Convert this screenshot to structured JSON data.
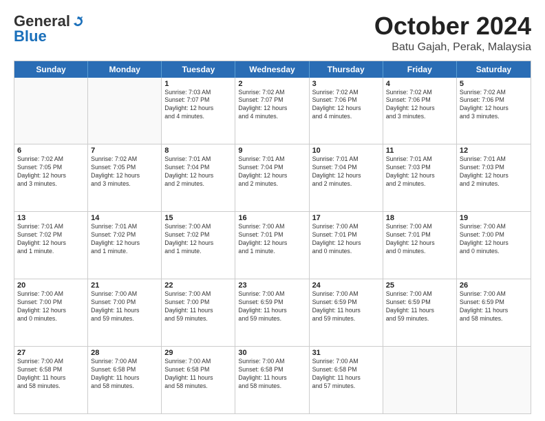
{
  "header": {
    "logo_general": "General",
    "logo_blue": "Blue",
    "month_title": "October 2024",
    "location": "Batu Gajah, Perak, Malaysia"
  },
  "days_of_week": [
    "Sunday",
    "Monday",
    "Tuesday",
    "Wednesday",
    "Thursday",
    "Friday",
    "Saturday"
  ],
  "weeks": [
    [
      {
        "day": "",
        "text": ""
      },
      {
        "day": "",
        "text": ""
      },
      {
        "day": "1",
        "text": "Sunrise: 7:03 AM\nSunset: 7:07 PM\nDaylight: 12 hours\nand 4 minutes."
      },
      {
        "day": "2",
        "text": "Sunrise: 7:02 AM\nSunset: 7:07 PM\nDaylight: 12 hours\nand 4 minutes."
      },
      {
        "day": "3",
        "text": "Sunrise: 7:02 AM\nSunset: 7:06 PM\nDaylight: 12 hours\nand 4 minutes."
      },
      {
        "day": "4",
        "text": "Sunrise: 7:02 AM\nSunset: 7:06 PM\nDaylight: 12 hours\nand 3 minutes."
      },
      {
        "day": "5",
        "text": "Sunrise: 7:02 AM\nSunset: 7:06 PM\nDaylight: 12 hours\nand 3 minutes."
      }
    ],
    [
      {
        "day": "6",
        "text": "Sunrise: 7:02 AM\nSunset: 7:05 PM\nDaylight: 12 hours\nand 3 minutes."
      },
      {
        "day": "7",
        "text": "Sunrise: 7:02 AM\nSunset: 7:05 PM\nDaylight: 12 hours\nand 3 minutes."
      },
      {
        "day": "8",
        "text": "Sunrise: 7:01 AM\nSunset: 7:04 PM\nDaylight: 12 hours\nand 2 minutes."
      },
      {
        "day": "9",
        "text": "Sunrise: 7:01 AM\nSunset: 7:04 PM\nDaylight: 12 hours\nand 2 minutes."
      },
      {
        "day": "10",
        "text": "Sunrise: 7:01 AM\nSunset: 7:04 PM\nDaylight: 12 hours\nand 2 minutes."
      },
      {
        "day": "11",
        "text": "Sunrise: 7:01 AM\nSunset: 7:03 PM\nDaylight: 12 hours\nand 2 minutes."
      },
      {
        "day": "12",
        "text": "Sunrise: 7:01 AM\nSunset: 7:03 PM\nDaylight: 12 hours\nand 2 minutes."
      }
    ],
    [
      {
        "day": "13",
        "text": "Sunrise: 7:01 AM\nSunset: 7:02 PM\nDaylight: 12 hours\nand 1 minute."
      },
      {
        "day": "14",
        "text": "Sunrise: 7:01 AM\nSunset: 7:02 PM\nDaylight: 12 hours\nand 1 minute."
      },
      {
        "day": "15",
        "text": "Sunrise: 7:00 AM\nSunset: 7:02 PM\nDaylight: 12 hours\nand 1 minute."
      },
      {
        "day": "16",
        "text": "Sunrise: 7:00 AM\nSunset: 7:01 PM\nDaylight: 12 hours\nand 1 minute."
      },
      {
        "day": "17",
        "text": "Sunrise: 7:00 AM\nSunset: 7:01 PM\nDaylight: 12 hours\nand 0 minutes."
      },
      {
        "day": "18",
        "text": "Sunrise: 7:00 AM\nSunset: 7:01 PM\nDaylight: 12 hours\nand 0 minutes."
      },
      {
        "day": "19",
        "text": "Sunrise: 7:00 AM\nSunset: 7:00 PM\nDaylight: 12 hours\nand 0 minutes."
      }
    ],
    [
      {
        "day": "20",
        "text": "Sunrise: 7:00 AM\nSunset: 7:00 PM\nDaylight: 12 hours\nand 0 minutes."
      },
      {
        "day": "21",
        "text": "Sunrise: 7:00 AM\nSunset: 7:00 PM\nDaylight: 11 hours\nand 59 minutes."
      },
      {
        "day": "22",
        "text": "Sunrise: 7:00 AM\nSunset: 7:00 PM\nDaylight: 11 hours\nand 59 minutes."
      },
      {
        "day": "23",
        "text": "Sunrise: 7:00 AM\nSunset: 6:59 PM\nDaylight: 11 hours\nand 59 minutes."
      },
      {
        "day": "24",
        "text": "Sunrise: 7:00 AM\nSunset: 6:59 PM\nDaylight: 11 hours\nand 59 minutes."
      },
      {
        "day": "25",
        "text": "Sunrise: 7:00 AM\nSunset: 6:59 PM\nDaylight: 11 hours\nand 59 minutes."
      },
      {
        "day": "26",
        "text": "Sunrise: 7:00 AM\nSunset: 6:59 PM\nDaylight: 11 hours\nand 58 minutes."
      }
    ],
    [
      {
        "day": "27",
        "text": "Sunrise: 7:00 AM\nSunset: 6:58 PM\nDaylight: 11 hours\nand 58 minutes."
      },
      {
        "day": "28",
        "text": "Sunrise: 7:00 AM\nSunset: 6:58 PM\nDaylight: 11 hours\nand 58 minutes."
      },
      {
        "day": "29",
        "text": "Sunrise: 7:00 AM\nSunset: 6:58 PM\nDaylight: 11 hours\nand 58 minutes."
      },
      {
        "day": "30",
        "text": "Sunrise: 7:00 AM\nSunset: 6:58 PM\nDaylight: 11 hours\nand 58 minutes."
      },
      {
        "day": "31",
        "text": "Sunrise: 7:00 AM\nSunset: 6:58 PM\nDaylight: 11 hours\nand 57 minutes."
      },
      {
        "day": "",
        "text": ""
      },
      {
        "day": "",
        "text": ""
      }
    ]
  ]
}
